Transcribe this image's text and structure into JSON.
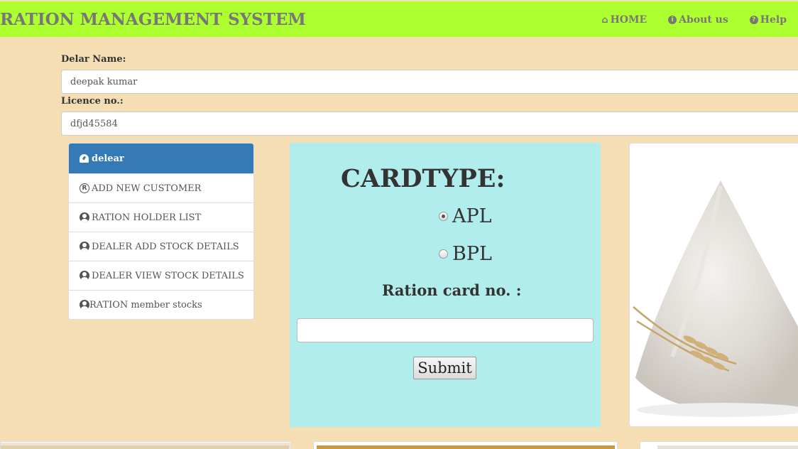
{
  "header": {
    "title": "RATION MANAGEMENT SYSTEM",
    "nav": [
      {
        "label": "HOME",
        "icon": "home-icon"
      },
      {
        "label": "About us",
        "icon": "info-icon"
      },
      {
        "label": "Help",
        "icon": "question-icon"
      }
    ]
  },
  "dealer_form": {
    "name_label": "Delar Name:",
    "name_value": "deepak kumar",
    "licence_label": "Licence no.:",
    "licence_value": "dfjd45584"
  },
  "sidebar": {
    "heading": "delear",
    "items": [
      {
        "label": "ADD NEW CUSTOMER",
        "icon": "registered-icon"
      },
      {
        "label": "RATION HOLDER LIST",
        "icon": "user-circle-icon"
      },
      {
        "label": "DEALER ADD STOCK DETAILS",
        "icon": "user-circle-icon"
      },
      {
        "label": "DEALER VIEW STOCK DETAILS",
        "icon": "user-circle-icon"
      },
      {
        "label": "RATION member stocks",
        "icon": "user-circle-icon"
      }
    ]
  },
  "card_form": {
    "title": "CARDTYPE:",
    "options": [
      {
        "label": "APL",
        "checked": true
      },
      {
        "label": "BPL",
        "checked": false
      }
    ],
    "card_no_label": "Ration card no. :",
    "card_no_value": "",
    "submit_label": "Submit"
  },
  "colors": {
    "header_bg": "#adff2f",
    "page_bg": "#f5deb3",
    "panel_bg": "#b2eded",
    "menu_active": "#337ab7"
  }
}
